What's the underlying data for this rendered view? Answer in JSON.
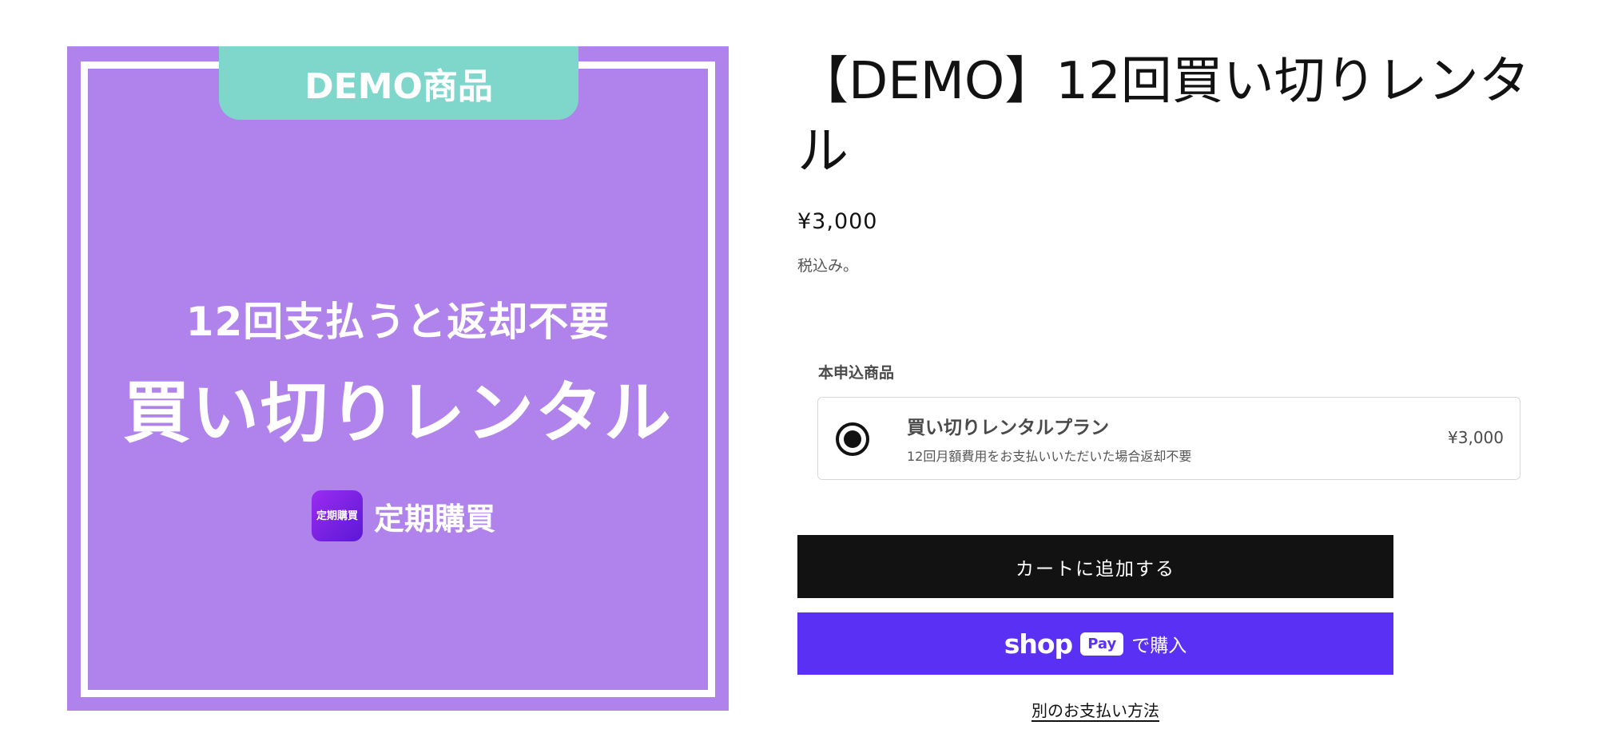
{
  "product_image": {
    "demo_tab": "DEMO商品",
    "subtitle": "12回支払うと返却不要",
    "title": "買い切りレンタル",
    "app_logo_text": "定期購買",
    "app_name": "定期購買",
    "colors": {
      "background": "#b083ec",
      "tab": "#7fd6cb",
      "frame": "#ffffff"
    }
  },
  "product": {
    "title": "【DEMO】12回買い切りレンタル",
    "price": "¥3,000",
    "tax_note": "税込み。"
  },
  "plan_section": {
    "label": "本申込商品",
    "option": {
      "name": "買い切りレンタルプラン",
      "description": "12回月額費用をお支払いいただいた場合返却不要",
      "price": "¥3,000",
      "selected": true
    }
  },
  "actions": {
    "add_to_cart": "カートに追加する",
    "shop_pay": {
      "brand": "shop",
      "pill": "Pay",
      "suffix": "で購入",
      "color": "#5a31f4"
    },
    "more_payment": "別のお支払い方法"
  }
}
